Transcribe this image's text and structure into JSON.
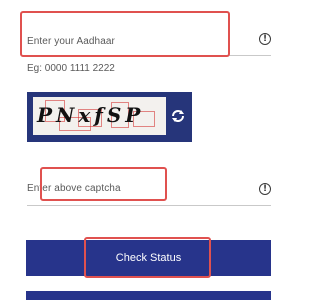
{
  "aadhaar": {
    "placeholder": "Enter your Aadhaar",
    "hint": "Eg: 0000 1111 2222",
    "info_icon": "info-icon"
  },
  "captcha": {
    "image_text": "PNxfSP",
    "refresh_icon": "refresh-icon",
    "placeholder": "Enter above captcha",
    "info_icon": "info-icon"
  },
  "actions": {
    "check_status_label": "Check Status"
  },
  "colors": {
    "primary": "#27348b",
    "highlight": "#e0514f"
  }
}
